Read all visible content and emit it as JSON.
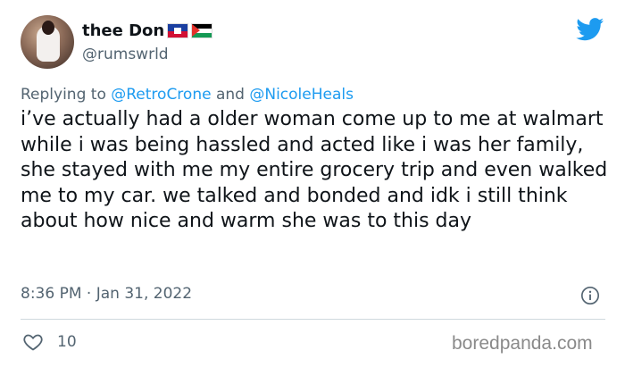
{
  "user": {
    "display_name": "thee Don",
    "handle": "@rumswrld",
    "flags": [
      "haiti-flag",
      "palestine-flag"
    ]
  },
  "reply": {
    "prefix": "Replying to",
    "mention1": "@RetroCrone",
    "joiner": "and",
    "mention2": "@NicoleHeals"
  },
  "tweet": {
    "text": "i’ve actually had a older woman come up to me at walmart while i was being hassled and acted like i was her family, she stayed with me my entire grocery trip and even walked me to my car. we talked and bonded and idk i still think about how nice and warm she was to this day",
    "timestamp": "8:36 PM · Jan 31, 2022"
  },
  "engagement": {
    "likes": "10"
  },
  "watermark": "boredpanda.com",
  "icons": {
    "brand": "twitter-bird-icon",
    "info": "info-icon",
    "like": "heart-icon"
  },
  "colors": {
    "accent": "#1d9bf0",
    "secondary_text": "#536471",
    "primary_text": "#0f1419"
  }
}
